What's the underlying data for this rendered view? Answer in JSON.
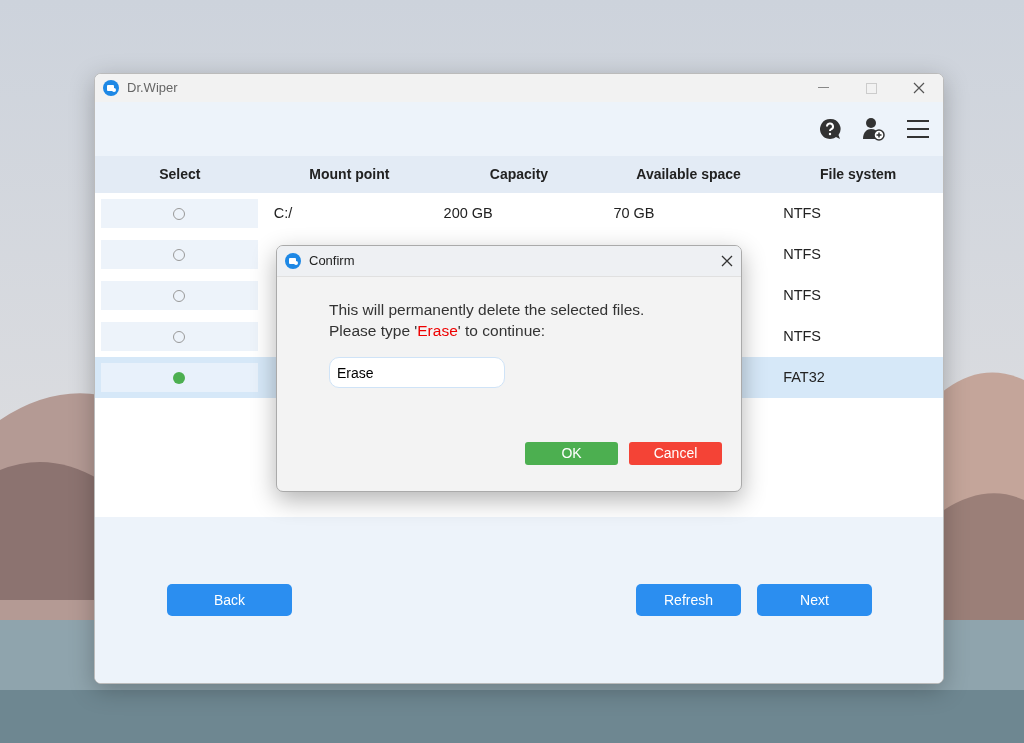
{
  "window": {
    "title": "Dr.Wiper"
  },
  "table": {
    "columns": [
      "Select",
      "Mount point",
      "Capacity",
      "Available space",
      "File system"
    ],
    "rows": [
      {
        "selected": false,
        "mount_point": "C:/",
        "capacity": "200 GB",
        "available_space": "70 GB",
        "file_system": "NTFS"
      },
      {
        "selected": false,
        "file_system": "NTFS"
      },
      {
        "selected": false,
        "file_system": "NTFS"
      },
      {
        "selected": false,
        "file_system": "NTFS"
      },
      {
        "selected": true,
        "file_system": "FAT32"
      }
    ]
  },
  "buttons": {
    "left": [
      "Back"
    ],
    "right": [
      "Refresh",
      "Next"
    ]
  },
  "dialog": {
    "title": "Confirm",
    "message": "This will permanently delete the selected files.",
    "prompt": {
      "before": "Please type '",
      "keyword": "Erase",
      "after": "' to continue:"
    },
    "input_value": "Erase",
    "ok": "OK",
    "cancel": "Cancel"
  }
}
